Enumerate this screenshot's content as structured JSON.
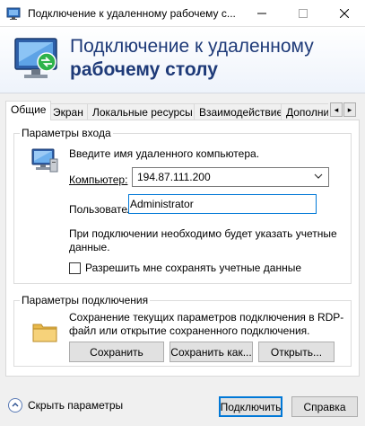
{
  "window": {
    "title": "Подключение к удаленному рабочему с...",
    "min_icon": "minimize-icon",
    "max_icon": "maximize-icon",
    "close_icon": "close-icon"
  },
  "banner": {
    "line1": "Подключение к удаленному",
    "line2": "рабочему столу"
  },
  "tabs": [
    {
      "label": "Общие",
      "active": true
    },
    {
      "label": "Экран",
      "active": false
    },
    {
      "label": "Локальные ресурсы",
      "active": false
    },
    {
      "label": "Взаимодействие",
      "active": false
    },
    {
      "label": "Дополни",
      "active": false
    }
  ],
  "tab_scroll": {
    "left": "◂",
    "right": "▸"
  },
  "login": {
    "group_label": "Параметры входа",
    "hint": "Введите имя удаленного компьютера.",
    "computer_label": "Компьютер:",
    "computer_value": "194.87.111.200",
    "user_label": "Пользователь:",
    "user_value": "Administrator",
    "note": "При подключении необходимо будет указать учетные данные.",
    "allow_save_label": "Разрешить мне сохранять учетные данные",
    "allow_save_checked": false
  },
  "connection": {
    "group_label": "Параметры подключения",
    "description": "Сохранение текущих параметров подключения в RDP-файл или открытие сохраненного подключения.",
    "save_label": "Сохранить",
    "save_as_label": "Сохранить как...",
    "open_label": "Открыть..."
  },
  "footer": {
    "hide_options_label": "Скрыть параметры",
    "connect_label": "Подключить",
    "help_label": "Справка"
  },
  "colors": {
    "banner_text": "#1e3a78",
    "focus_border": "#0078d7"
  }
}
